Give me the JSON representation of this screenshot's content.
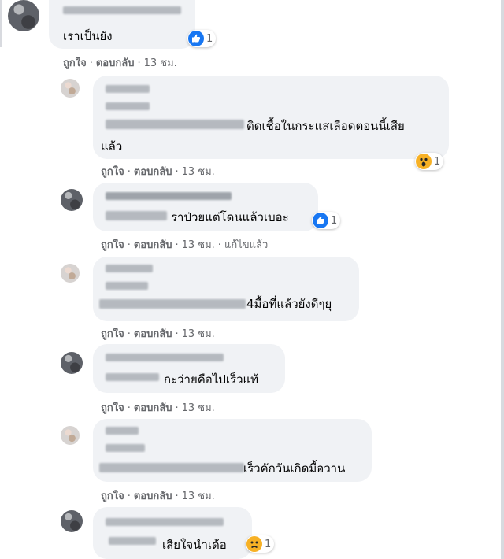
{
  "comments": [
    {
      "id": "c1",
      "text": "เราเป็นยัง",
      "reaction": {
        "icon": "like-icon",
        "count": "1"
      },
      "meta": [
        "ถูกใจ",
        "ตอบกลับ",
        "13 ชม."
      ]
    },
    {
      "id": "c2",
      "text": "ติดเชื้อในกระแสเลือดตอนนี้เสีย",
      "text2": "แล้ว",
      "reaction": {
        "icon": "wow-icon",
        "count": "1"
      },
      "meta": [
        "ถูกใจ",
        "ตอบกลับ",
        "13 ชม."
      ]
    },
    {
      "id": "c3",
      "text": "ราป่วยแต่โดนแล้วเบอะ",
      "reaction": {
        "icon": "like-icon",
        "count": "1"
      },
      "meta": [
        "ถูกใจ",
        "ตอบกลับ",
        "13 ชม.",
        "แก้ไขแล้ว"
      ]
    },
    {
      "id": "c4",
      "text": "4มื้อที่แล้วยังดีๆยุ",
      "meta": [
        "ถูกใจ",
        "ตอบกลับ",
        "13 ชม."
      ]
    },
    {
      "id": "c5",
      "text": "กะว่ายคือไปเร็วแท้",
      "meta": [
        "ถูกใจ",
        "ตอบกลับ",
        "13 ชม."
      ]
    },
    {
      "id": "c6",
      "text": "เร็วคักวันเกิดมื้อวาน",
      "meta": [
        "ถูกใจ",
        "ตอบกลับ",
        "13 ชม."
      ]
    },
    {
      "id": "c7",
      "text": "เสียใจนำเด้อ",
      "reaction": {
        "icon": "sad-icon",
        "count": "1"
      }
    }
  ],
  "colors": {
    "bubble": "#f0f2f5",
    "meta": "#65676b",
    "like": "#1877f2",
    "emoji": "#f7b125"
  }
}
